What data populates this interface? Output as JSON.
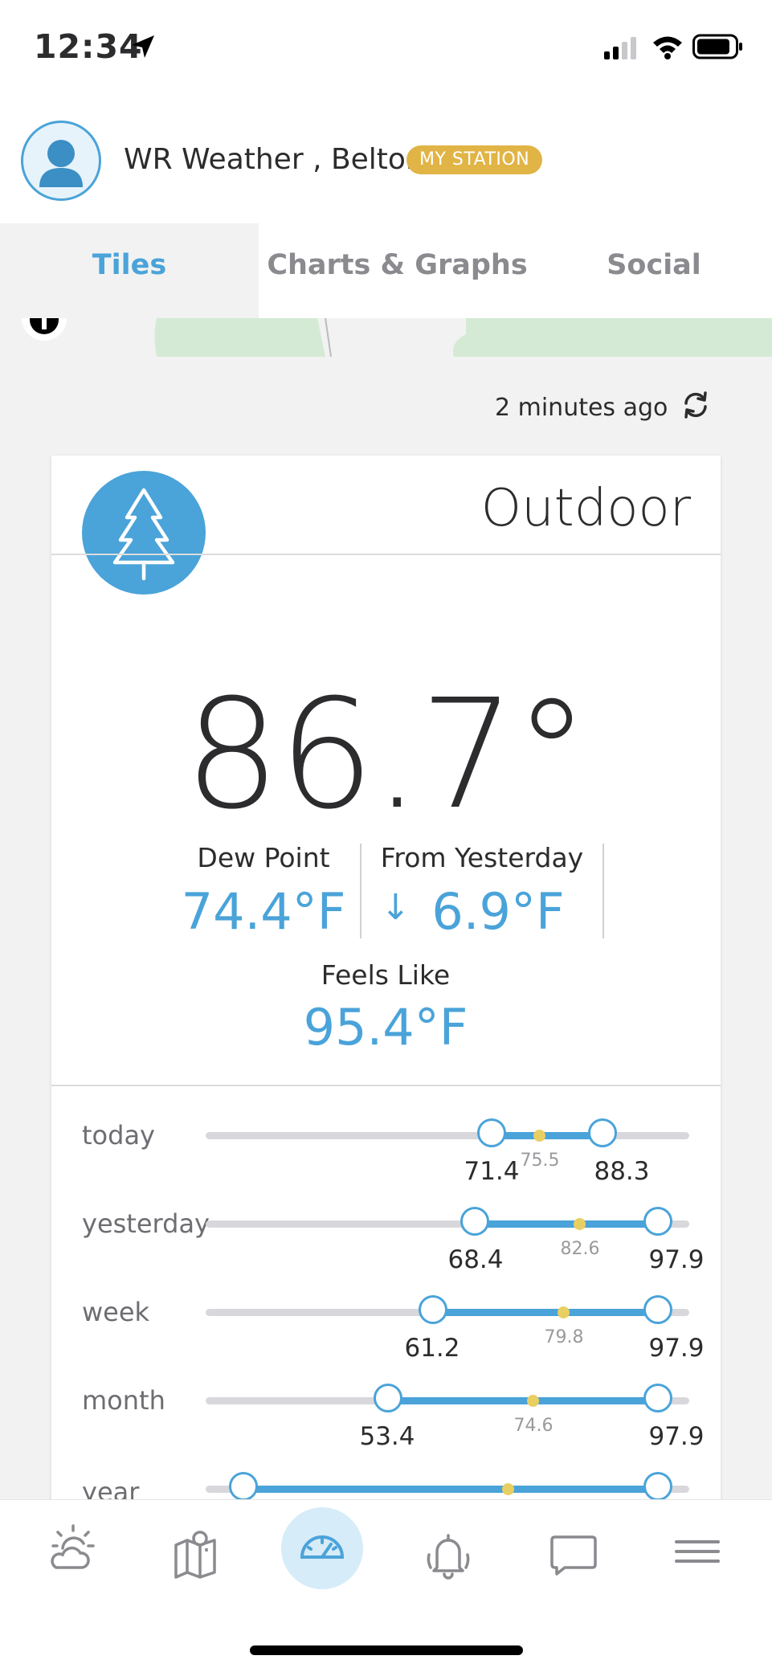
{
  "status_bar": {
    "time": "12:34"
  },
  "header": {
    "station_name": "WR Weather , Belton",
    "badge": "MY STATION"
  },
  "tabs": [
    {
      "label": "Tiles",
      "active": true
    },
    {
      "label": "Charts & Graphs",
      "active": false
    },
    {
      "label": "Social",
      "active": false
    }
  ],
  "updated": "2 minutes ago",
  "card": {
    "title": "Outdoor",
    "temperature": "86.7°",
    "dew_point": {
      "label": "Dew Point",
      "value": "74.4°F"
    },
    "from_yesterday": {
      "label": "From Yesterday",
      "arrow": "↓",
      "value": "6.9°F"
    },
    "feels_like": {
      "label": "Feels Like",
      "value": "95.4°F"
    },
    "ranges": [
      {
        "label": "today",
        "low": "71.4",
        "avg": "75.5",
        "high": "88.3"
      },
      {
        "label": "yesterday",
        "low": "68.4",
        "avg": "82.6",
        "high": "97.9"
      },
      {
        "label": "week",
        "low": "61.2",
        "avg": "79.8",
        "high": "97.9"
      },
      {
        "label": "month",
        "low": "53.4",
        "avg": "74.6",
        "high": "97.9"
      },
      {
        "label": "year",
        "low": "",
        "avg": "",
        "high": ""
      }
    ]
  },
  "nav": [
    {
      "icon": "weather-icon"
    },
    {
      "icon": "map-icon"
    },
    {
      "icon": "dashboard-icon",
      "active": true
    },
    {
      "icon": "alerts-icon"
    },
    {
      "icon": "chat-icon"
    },
    {
      "icon": "menu-icon"
    }
  ],
  "colors": {
    "accent": "#4aa3d9",
    "badge": "#e1b446",
    "avg_dot": "#e9cf62"
  }
}
